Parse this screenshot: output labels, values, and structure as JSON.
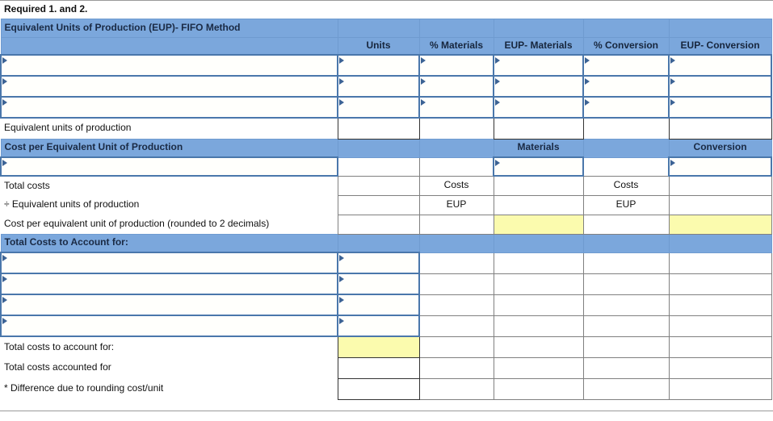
{
  "title": "Required 1. and 2.",
  "sections": {
    "eup": {
      "heading": "Equivalent Units of Production (EUP)- FIFO Method",
      "columns": [
        "",
        "Units",
        "% Materials",
        "EUP- Materials",
        "% Conversion",
        "EUP- Conversion"
      ],
      "input_rows": [
        "",
        "",
        ""
      ],
      "total_row_label": "Equivalent units of production"
    },
    "cost_per_unit": {
      "heading": "Cost per Equivalent Unit of Production",
      "subheaders": {
        "materials": "Materials",
        "conversion": "Conversion"
      },
      "rows": [
        {
          "label": "",
          "pmat": "",
          "pcon": "",
          "type": "input"
        },
        {
          "label": "Total costs",
          "pmat": "Costs",
          "pcon": "Costs",
          "type": "plain"
        },
        {
          "label": "÷ Equivalent units of production",
          "pmat": "EUP",
          "pcon": "EUP",
          "type": "plain"
        },
        {
          "label": "Cost per equivalent unit of production (rounded to 2 decimals)",
          "pmat": "",
          "pcon": "",
          "type": "result"
        }
      ]
    },
    "total_costs": {
      "heading": "Total Costs to Account for:",
      "input_rows": [
        "",
        "",
        "",
        ""
      ],
      "summary_rows": [
        {
          "label": "Total costs to account for:",
          "highlight": true
        },
        {
          "label": "Total costs accounted for",
          "highlight": false
        },
        {
          "label": "* Difference due to rounding cost/unit",
          "highlight": false
        }
      ]
    }
  },
  "colors": {
    "header_blue": "#7BA7DC",
    "input_border": "#4a77ab",
    "highlight_yellow": "#FBFBAE",
    "grid_gray": "#808080"
  }
}
